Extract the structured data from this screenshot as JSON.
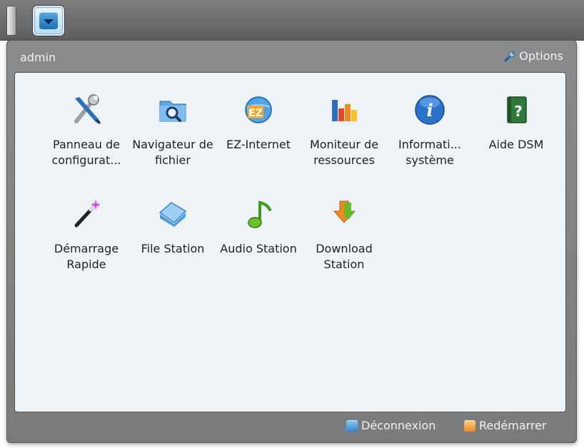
{
  "panel": {
    "username": "admin",
    "options_label": "Options"
  },
  "apps": [
    {
      "label": "Panneau de configurat...",
      "icon": "tools-icon"
    },
    {
      "label": "Navigateur de fichier",
      "icon": "folder-search-icon"
    },
    {
      "label": "EZ-Internet",
      "icon": "ez-internet-icon"
    },
    {
      "label": "Moniteur de ressources",
      "icon": "bar-chart-icon"
    },
    {
      "label": "Informati... système",
      "icon": "info-icon"
    },
    {
      "label": "Aide DSM",
      "icon": "help-book-icon"
    },
    {
      "label": "Démarrage Rapide",
      "icon": "magic-wand-icon"
    },
    {
      "label": "File Station",
      "icon": "blue-folder-icon"
    },
    {
      "label": "Audio Station",
      "icon": "music-note-icon"
    },
    {
      "label": "Download Station",
      "icon": "download-arrow-icon"
    }
  ],
  "footer": {
    "logout_label": "Déconnexion",
    "restart_label": "Redémarrer"
  },
  "colors": {
    "taskbar": "#6a6b6d",
    "panel": "#7a7b7d",
    "content_bg": "#eef3f8",
    "accent_blue": "#1f6fb3",
    "accent_orange": "#f28a1c"
  }
}
